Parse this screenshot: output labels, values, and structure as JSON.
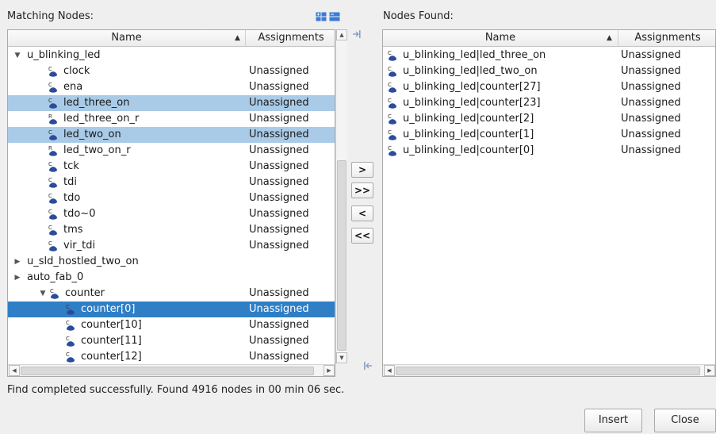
{
  "left_panel": {
    "title": "Matching Nodes:",
    "columns": {
      "name": "Name",
      "assignments": "Assignments"
    },
    "rows": [
      {
        "name": "u_blinking_led",
        "assign": "",
        "indent": 0,
        "toggle": "▼",
        "icon": "",
        "sel": ""
      },
      {
        "name": "clock",
        "assign": "Unassigned",
        "indent": 1,
        "toggle": "",
        "icon": "C",
        "sel": ""
      },
      {
        "name": "ena",
        "assign": "Unassigned",
        "indent": 1,
        "toggle": "",
        "icon": "C",
        "sel": ""
      },
      {
        "name": "led_three_on",
        "assign": "Unassigned",
        "indent": 1,
        "toggle": "",
        "icon": "C",
        "sel": "light"
      },
      {
        "name": "led_three_on_r",
        "assign": "Unassigned",
        "indent": 1,
        "toggle": "",
        "icon": "R",
        "sel": ""
      },
      {
        "name": "led_two_on",
        "assign": "Unassigned",
        "indent": 1,
        "toggle": "",
        "icon": "C",
        "sel": "light"
      },
      {
        "name": "led_two_on_r",
        "assign": "Unassigned",
        "indent": 1,
        "toggle": "",
        "icon": "R",
        "sel": ""
      },
      {
        "name": "tck",
        "assign": "Unassigned",
        "indent": 1,
        "toggle": "",
        "icon": "C",
        "sel": ""
      },
      {
        "name": "tdi",
        "assign": "Unassigned",
        "indent": 1,
        "toggle": "",
        "icon": "C",
        "sel": ""
      },
      {
        "name": "tdo",
        "assign": "Unassigned",
        "indent": 1,
        "toggle": "",
        "icon": "C",
        "sel": ""
      },
      {
        "name": "tdo~0",
        "assign": "Unassigned",
        "indent": 1,
        "toggle": "",
        "icon": "C",
        "sel": ""
      },
      {
        "name": "tms",
        "assign": "Unassigned",
        "indent": 1,
        "toggle": "",
        "icon": "C",
        "sel": ""
      },
      {
        "name": "vir_tdi",
        "assign": "Unassigned",
        "indent": 1,
        "toggle": "",
        "icon": "C",
        "sel": ""
      },
      {
        "name": "u_sld_hostled_two_on",
        "assign": "",
        "indent": 0,
        "toggle": "▶",
        "icon": "",
        "sel": ""
      },
      {
        "name": "auto_fab_0",
        "assign": "",
        "indent": 0,
        "toggle": "▶",
        "icon": "",
        "sel": ""
      },
      {
        "name": "counter",
        "assign": "Unassigned",
        "indent": 1,
        "toggle": "▼",
        "icon": "C",
        "sel": ""
      },
      {
        "name": "counter[0]",
        "assign": "Unassigned",
        "indent": 2,
        "toggle": "",
        "icon": "C",
        "sel": "dark"
      },
      {
        "name": "counter[10]",
        "assign": "Unassigned",
        "indent": 2,
        "toggle": "",
        "icon": "C",
        "sel": ""
      },
      {
        "name": "counter[11]",
        "assign": "Unassigned",
        "indent": 2,
        "toggle": "",
        "icon": "C",
        "sel": ""
      },
      {
        "name": "counter[12]",
        "assign": "Unassigned",
        "indent": 2,
        "toggle": "",
        "icon": "C",
        "sel": ""
      }
    ]
  },
  "right_panel": {
    "title": "Nodes Found:",
    "columns": {
      "name": "Name",
      "assignments": "Assignments"
    },
    "rows": [
      {
        "name": "u_blinking_led|led_three_on",
        "assign": "Unassigned"
      },
      {
        "name": "u_blinking_led|led_two_on",
        "assign": "Unassigned"
      },
      {
        "name": "u_blinking_led|counter[27]",
        "assign": "Unassigned"
      },
      {
        "name": "u_blinking_led|counter[23]",
        "assign": "Unassigned"
      },
      {
        "name": "u_blinking_led|counter[2]",
        "assign": "Unassigned"
      },
      {
        "name": "u_blinking_led|counter[1]",
        "assign": "Unassigned"
      },
      {
        "name": "u_blinking_led|counter[0]",
        "assign": "Unassigned"
      }
    ]
  },
  "move_buttons": {
    "add": ">",
    "add_all": ">>",
    "remove": "<",
    "remove_all": "<<"
  },
  "status_text": "Find completed successfully. Found 4916 nodes in 00 min 06 sec.",
  "dialog_buttons": {
    "insert": "Insert",
    "close": "Close"
  },
  "icons": {
    "expand_all": "expand-all-icon",
    "collapse_all": "collapse-all-icon",
    "dock": "dock-icon",
    "node": "node-icon",
    "register": "register-icon"
  },
  "colors": {
    "selection_light": "#a9cbe7",
    "selection_dark": "#2f7fc6",
    "icon_blue": "#2a4d9b"
  }
}
